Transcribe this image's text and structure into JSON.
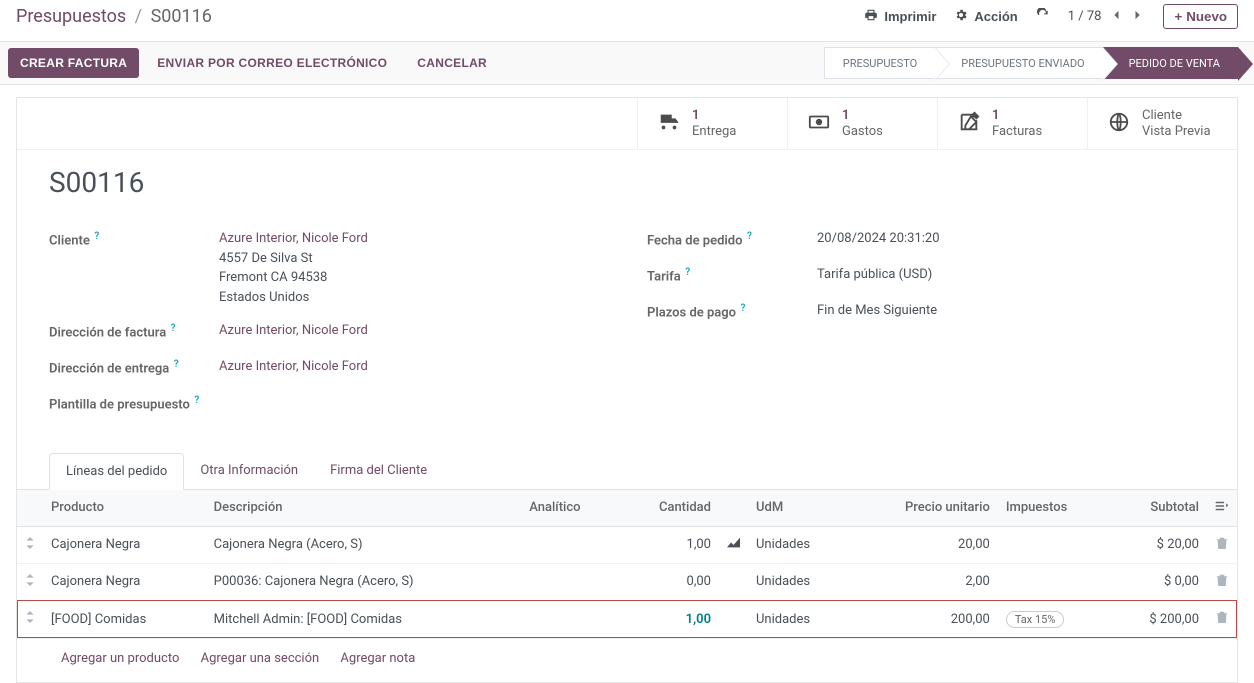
{
  "breadcrumb": {
    "parent": "Presupuestos",
    "current": "S00116"
  },
  "controls": {
    "print": "Imprimir",
    "action": "Acción",
    "pager": "1 / 78",
    "new": "Nuevo"
  },
  "actions": {
    "create_invoice": "CREAR FACTURA",
    "send_email": "ENVIAR POR CORREO ELECTRÓNICO",
    "cancel": "CANCELAR"
  },
  "status_steps": [
    "PRESUPUESTO",
    "PRESUPUESTO ENVIADO",
    "PEDIDO DE VENTA"
  ],
  "stats": {
    "delivery": {
      "count": "1",
      "label": "Entrega"
    },
    "expenses": {
      "count": "1",
      "label": "Gastos"
    },
    "invoices": {
      "count": "1",
      "label": "Facturas"
    },
    "preview": {
      "count": "Cliente",
      "label": "Vista Previa"
    }
  },
  "record": {
    "name": "S00116",
    "labels": {
      "customer": "Cliente",
      "invoice_addr": "Dirección de factura",
      "delivery_addr": "Dirección de entrega",
      "template": "Plantilla de presupuesto",
      "order_date": "Fecha de pedido",
      "pricelist": "Tarifa",
      "payment_terms": "Plazos de pago"
    },
    "customer_name": "Azure Interior, Nicole Ford",
    "customer_addr_street": "4557 De Silva St",
    "customer_addr_city": "Fremont CA 94538",
    "customer_addr_country": "Estados Unidos",
    "invoice_address": "Azure Interior, Nicole Ford",
    "delivery_address": "Azure Interior, Nicole Ford",
    "order_date": "20/08/2024 20:31:20",
    "pricelist": "Tarifa pública (USD)",
    "payment_terms": "Fin de Mes Siguiente"
  },
  "tabs": [
    "Líneas del pedido",
    "Otra Información",
    "Firma del Cliente"
  ],
  "table_headers": {
    "product": "Producto",
    "description": "Descripción",
    "analytic": "Analítico",
    "qty": "Cantidad",
    "uom": "UdM",
    "price": "Precio unitario",
    "taxes": "Impuestos",
    "subtotal": "Subtotal"
  },
  "lines": [
    {
      "product": "Cajonera Negra",
      "desc": "Cajonera Negra (Acero, S)",
      "qty": "1,00",
      "uom": "Unidades",
      "price": "20,00",
      "tax": "",
      "subtotal": "$ 20,00"
    },
    {
      "product": "Cajonera Negra",
      "desc": "P00036: Cajonera Negra (Acero, S)",
      "qty": "0,00",
      "uom": "Unidades",
      "price": "2,00",
      "tax": "",
      "subtotal": "$ 0,00"
    },
    {
      "product": "[FOOD] Comidas",
      "desc": "Mitchell Admin: [FOOD] Comidas",
      "qty": "1,00",
      "uom": "Unidades",
      "price": "200,00",
      "tax": "Tax 15%",
      "subtotal": "$ 200,00"
    }
  ],
  "add_actions": {
    "product": "Agregar un producto",
    "section": "Agregar una sección",
    "note": "Agregar nota"
  }
}
